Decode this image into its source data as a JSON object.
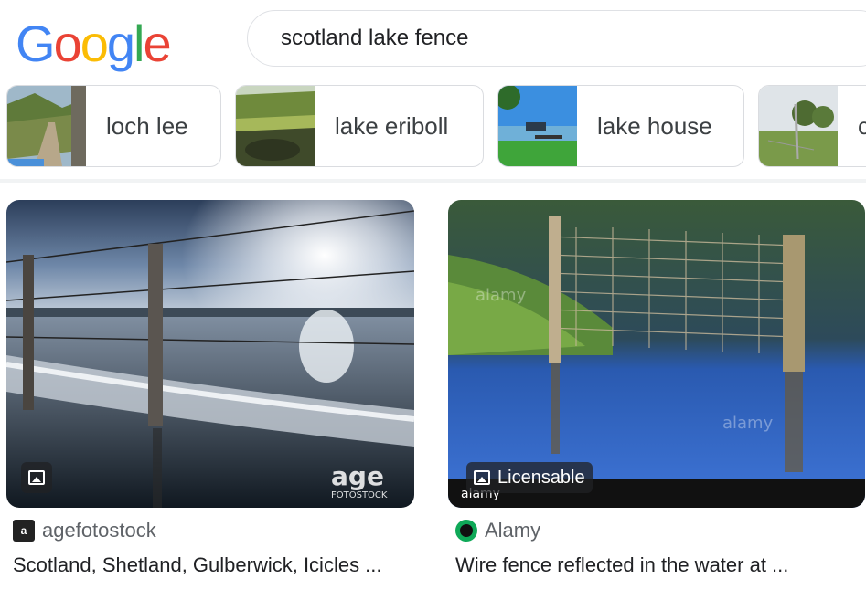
{
  "header": {
    "logo_letters": [
      {
        "char": "G",
        "color": "#4285F4"
      },
      {
        "char": "o",
        "color": "#EA4335"
      },
      {
        "char": "o",
        "color": "#FBBC05"
      },
      {
        "char": "g",
        "color": "#4285F4"
      },
      {
        "char": "l",
        "color": "#34A853"
      },
      {
        "char": "e",
        "color": "#EA4335"
      }
    ],
    "search_query": "scotland lake fence"
  },
  "chips": [
    {
      "label": "loch lee"
    },
    {
      "label": "lake eriboll"
    },
    {
      "label": "lake house"
    },
    {
      "label": "c"
    }
  ],
  "results": [
    {
      "source": "agefotostock",
      "caption": "Scotland, Shetland, Gulberwick, Icicles ...",
      "watermark": "age FOTOSTOCK",
      "badge_icon": "image-icon"
    },
    {
      "source": "Alamy",
      "caption": "Wire fence reflected in the water at ...",
      "badge_label": "Licensable",
      "watermark": "alamy",
      "badge_icon": "image-icon"
    }
  ],
  "colors": {
    "alamy_favicon": "#0fa958",
    "chip_border": "#dadce0",
    "search_border": "#dfe1e5"
  }
}
